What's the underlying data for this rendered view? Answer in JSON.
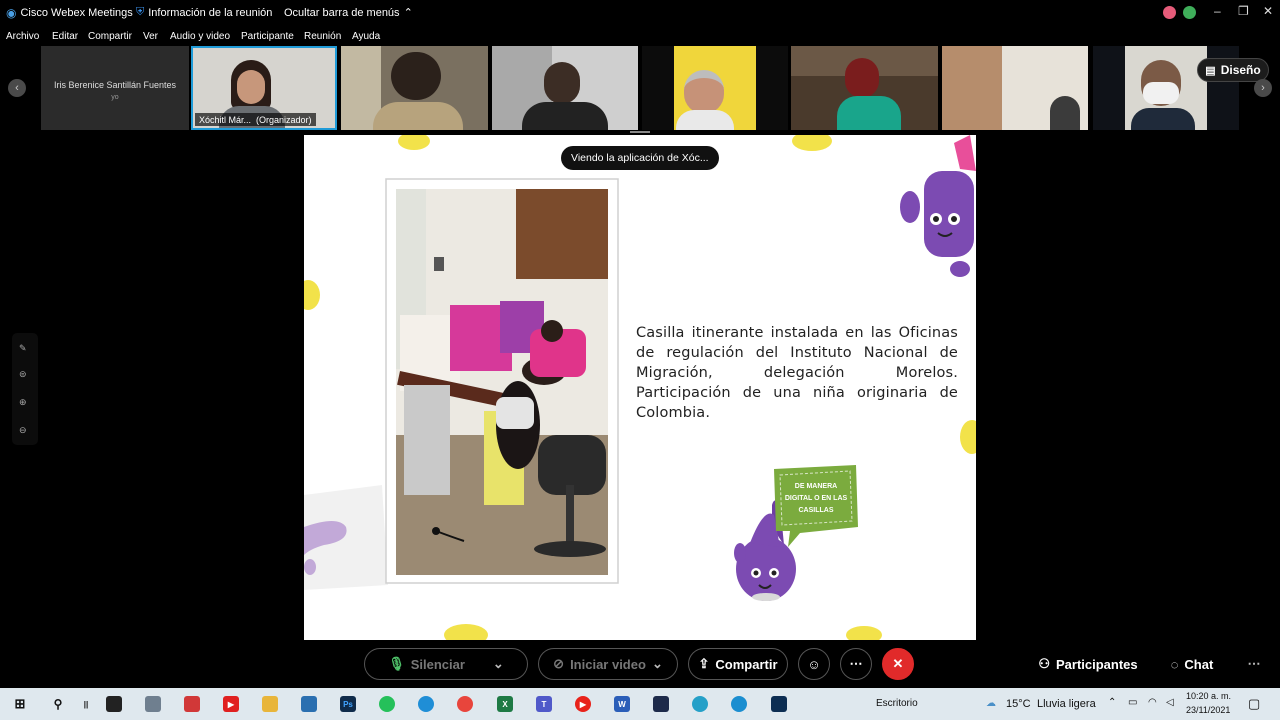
{
  "app": {
    "title": "Cisco Webex Meetings",
    "meeting_info": "Información de la reunión",
    "hide_menu": "Ocultar barra de menús"
  },
  "menu": [
    "Archivo",
    "Editar",
    "Compartir",
    "Ver",
    "Audio y video",
    "Participante",
    "Reunión",
    "Ayuda"
  ],
  "self_tile": {
    "name": "Iris Berenice Santillán Fuentes",
    "sub": "yo"
  },
  "active_speaker": {
    "name": "Xóchitl Már...",
    "role": "(Organizador)"
  },
  "layout_button": "Diseño",
  "viewing_label": "Viendo la aplicación de Xóc...",
  "slide": {
    "caption": "Casilla itinerante instalada en las Oficinas de regulación del Instituto Nacional de Migración, delegación Morelos. Participación de una niña originaria de Colombia.",
    "bubble": "DE MANERA DIGITAL O EN LAS CASILLAS"
  },
  "controls": {
    "mute": "Silenciar",
    "video": "Iniciar video",
    "share": "Compartir",
    "participants": "Participantes",
    "chat": "Chat"
  },
  "taskbar": {
    "desktop": "Escritorio",
    "temp": "15°C",
    "weather": "Lluvia ligera",
    "time": "10:20 a. m.",
    "date": "23/11/2021"
  },
  "colors": {
    "accent_blue": "#1f9bd8",
    "end_red": "#e12a2a",
    "slide_yellow": "#f2e24a",
    "mascot_purple": "#7c4bb2",
    "bubble_green": "#7bab3e"
  }
}
